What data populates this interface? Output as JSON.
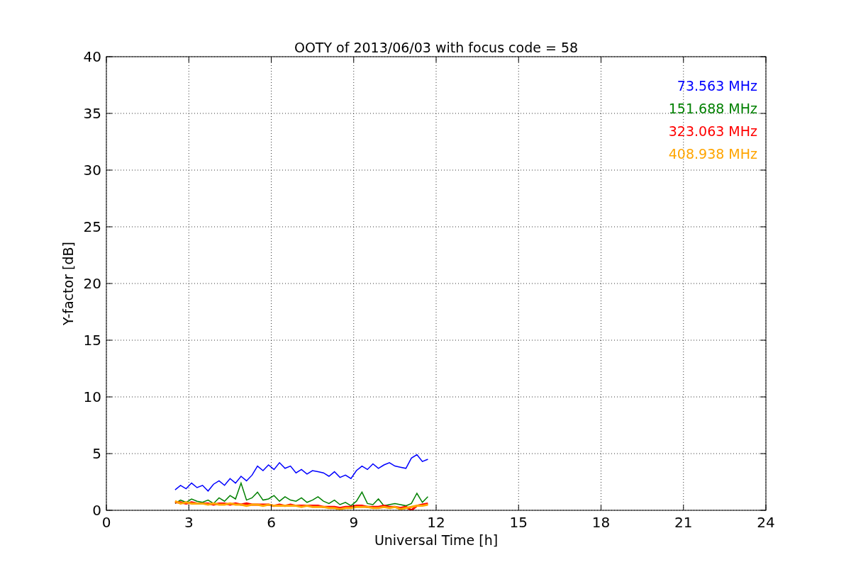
{
  "figure": {
    "chart_data": {
      "type": "line",
      "title": "OOTY of 2013/06/03 with focus code = 58",
      "xlabel": "Universal Time [h]",
      "ylabel": "Y-factor [dB]",
      "grid": true,
      "xlim": [
        0,
        24
      ],
      "ylim": [
        0,
        40
      ],
      "xticks": [
        0,
        3,
        6,
        9,
        12,
        15,
        18,
        21,
        24
      ],
      "yticks": [
        0,
        5,
        10,
        15,
        20,
        25,
        30,
        35,
        40
      ],
      "x": [
        2.5,
        2.7,
        2.9,
        3.1,
        3.3,
        3.5,
        3.7,
        3.9,
        4.1,
        4.3,
        4.5,
        4.7,
        4.9,
        5.1,
        5.3,
        5.5,
        5.7,
        5.9,
        6.1,
        6.3,
        6.5,
        6.7,
        6.9,
        7.1,
        7.3,
        7.5,
        7.7,
        7.9,
        8.1,
        8.3,
        8.5,
        8.7,
        8.9,
        9.1,
        9.3,
        9.5,
        9.7,
        9.9,
        10.1,
        10.3,
        10.5,
        10.7,
        10.9,
        11.1,
        11.3,
        11.5,
        11.7
      ],
      "series": [
        {
          "name": "73.563 MHz",
          "color": "#0000ff",
          "values": [
            1.8,
            2.2,
            1.9,
            2.4,
            2.0,
            2.2,
            1.7,
            2.3,
            2.6,
            2.2,
            2.8,
            2.4,
            3.0,
            2.6,
            3.1,
            3.9,
            3.5,
            4.0,
            3.6,
            4.2,
            3.7,
            3.9,
            3.3,
            3.6,
            3.2,
            3.5,
            3.4,
            3.3,
            3.0,
            3.4,
            2.9,
            3.1,
            2.8,
            3.5,
            3.9,
            3.6,
            4.1,
            3.7,
            4.0,
            4.2,
            3.9,
            3.8,
            3.7,
            4.6,
            4.9,
            4.3,
            4.5
          ]
        },
        {
          "name": "151.688 MHz",
          "color": "#008000",
          "values": [
            0.6,
            0.9,
            0.7,
            1.0,
            0.8,
            0.7,
            0.9,
            0.6,
            1.1,
            0.8,
            1.3,
            1.0,
            2.4,
            0.9,
            1.1,
            1.6,
            0.9,
            1.0,
            1.3,
            0.8,
            1.2,
            0.9,
            0.8,
            1.1,
            0.7,
            0.9,
            1.2,
            0.8,
            0.6,
            0.9,
            0.5,
            0.7,
            0.4,
            0.8,
            1.6,
            0.6,
            0.5,
            1.0,
            0.4,
            0.5,
            0.6,
            0.5,
            0.4,
            0.6,
            1.5,
            0.7,
            1.2
          ]
        },
        {
          "name": "323.063 MHz",
          "color": "#ff0000",
          "values": [
            0.7,
            0.7,
            0.6,
            0.7,
            0.6,
            0.6,
            0.6,
            0.5,
            0.6,
            0.6,
            0.5,
            0.6,
            0.5,
            0.6,
            0.5,
            0.5,
            0.5,
            0.5,
            0.4,
            0.5,
            0.4,
            0.5,
            0.4,
            0.4,
            0.4,
            0.4,
            0.4,
            0.3,
            0.3,
            0.3,
            0.2,
            0.3,
            0.3,
            0.4,
            0.4,
            0.3,
            0.3,
            0.3,
            0.4,
            0.3,
            0.3,
            0.2,
            0.3,
            0.0,
            0.4,
            0.5,
            0.6
          ]
        },
        {
          "name": "408.938 MHz",
          "color": "#ffa500",
          "values": [
            0.8,
            0.6,
            0.7,
            0.6,
            0.6,
            0.6,
            0.5,
            0.6,
            0.5,
            0.5,
            0.6,
            0.5,
            0.5,
            0.4,
            0.5,
            0.5,
            0.4,
            0.5,
            0.4,
            0.4,
            0.4,
            0.4,
            0.4,
            0.3,
            0.4,
            0.3,
            0.3,
            0.3,
            0.2,
            0.2,
            0.1,
            0.2,
            0.2,
            0.3,
            0.3,
            0.3,
            0.2,
            0.2,
            0.3,
            0.2,
            0.3,
            0.1,
            0.2,
            0.3,
            0.4,
            0.4,
            0.5
          ]
        }
      ]
    }
  }
}
